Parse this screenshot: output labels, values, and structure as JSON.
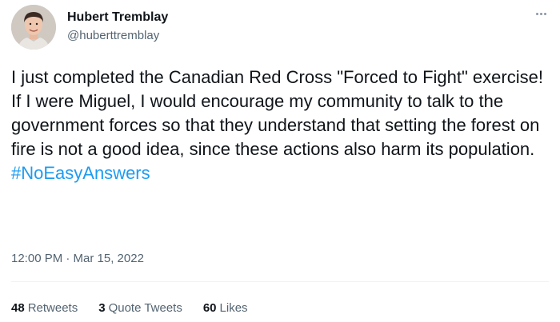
{
  "user": {
    "display_name": "Hubert Tremblay",
    "handle": "@huberttremblay"
  },
  "tweet": {
    "text": "I just completed the Canadian Red Cross \"Forced to Fight\" exercise! If I were Miguel, I would encourage my community to talk to the government forces so that they understand that setting the forest on fire is not a good idea, since these actions also harm its population. ",
    "hashtag": "#NoEasyAnswers",
    "timestamp": "12:00 PM · Mar 15, 2022"
  },
  "stats": {
    "retweets_count": "48",
    "retweets_label": "Retweets",
    "quote_tweets_count": "3",
    "quote_tweets_label": "Quote Tweets",
    "likes_count": "60",
    "likes_label": "Likes"
  },
  "icons": {
    "more": "more-horizontal-icon"
  },
  "colors": {
    "hashtag": "#1d9bf0",
    "secondary_text": "#536471",
    "primary_text": "#0f1419"
  }
}
